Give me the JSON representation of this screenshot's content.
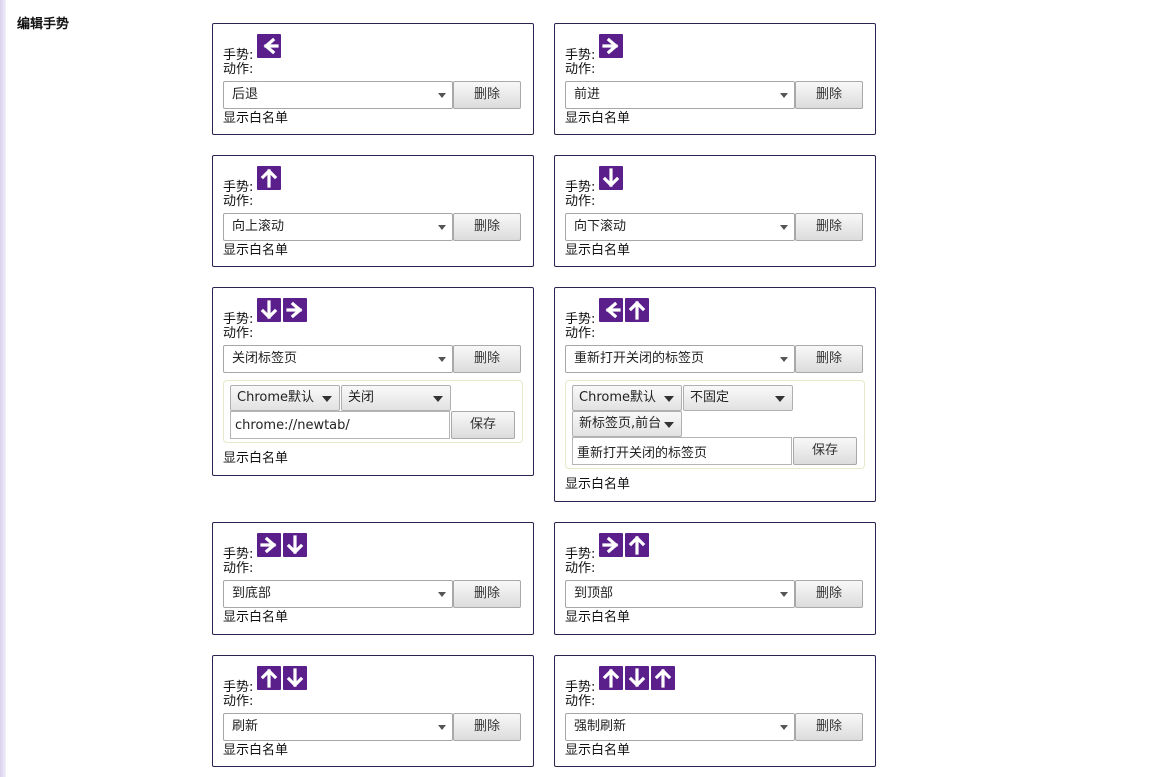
{
  "page": {
    "title": "编辑手势"
  },
  "labels": {
    "gesture": "手势:",
    "action": "动作:",
    "delete": "删除",
    "whitelist": "显示白名单",
    "save": "保存"
  },
  "cards": [
    {
      "gesture": [
        "left"
      ],
      "action": "后退"
    },
    {
      "gesture": [
        "right"
      ],
      "action": "前进"
    },
    {
      "gesture": [
        "up"
      ],
      "action": "向上滚动"
    },
    {
      "gesture": [
        "down"
      ],
      "action": "向下滚动"
    },
    {
      "gesture": [
        "down",
        "right"
      ],
      "action": "关闭标签页",
      "options": {
        "dropdowns": [
          "Chrome默认",
          "关闭"
        ],
        "text_value": "chrome://newtab/"
      }
    },
    {
      "gesture": [
        "left",
        "up"
      ],
      "action": "重新打开关闭的标签页",
      "options": {
        "dropdowns": [
          "Chrome默认",
          "不固定",
          "新标签页,前台"
        ],
        "text_value": "重新打开关闭的标签页"
      }
    },
    {
      "gesture": [
        "right",
        "down"
      ],
      "action": "到底部"
    },
    {
      "gesture": [
        "right",
        "up"
      ],
      "action": "到顶部"
    },
    {
      "gesture": [
        "up",
        "down"
      ],
      "action": "刷新"
    },
    {
      "gesture": [
        "up",
        "down",
        "up"
      ],
      "action": "强制刷新"
    }
  ],
  "colors": {
    "arrow_bg": "#5a1f8a",
    "card_border": "#2b2450"
  },
  "icons": {
    "left": "arrow-left-icon",
    "right": "arrow-right-icon",
    "up": "arrow-up-icon",
    "down": "arrow-down-icon"
  }
}
